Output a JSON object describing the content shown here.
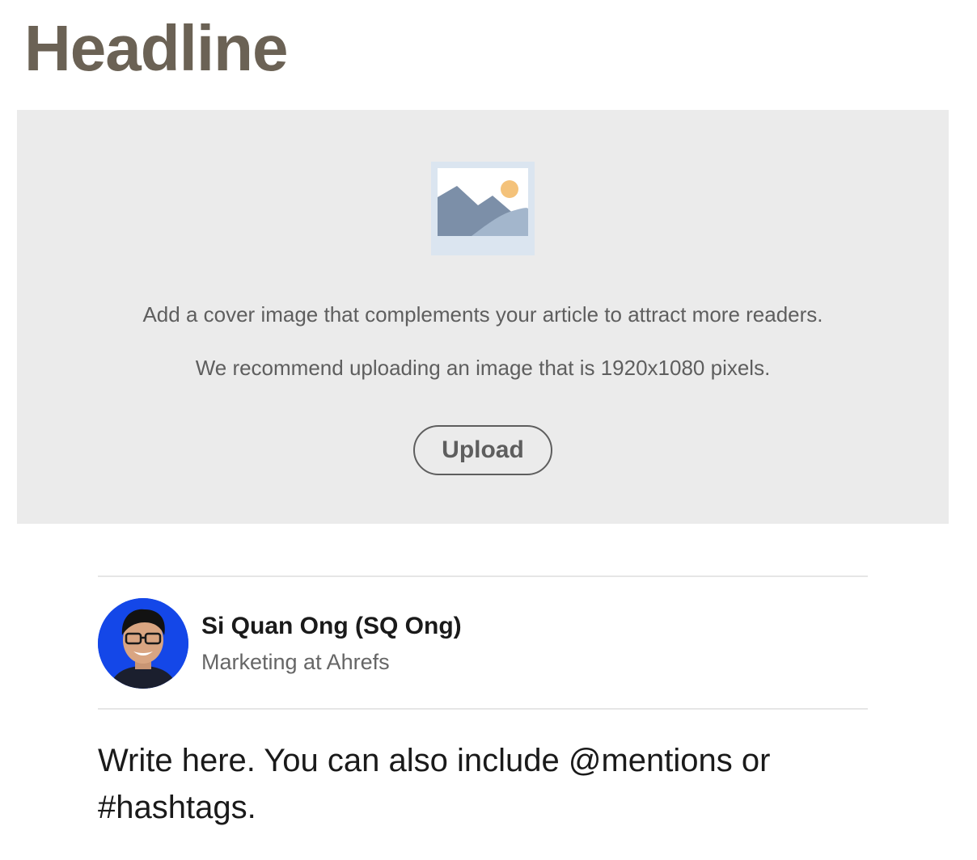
{
  "headline": {
    "placeholder": "Headline"
  },
  "cover": {
    "icon": "image-placeholder-icon",
    "description": "Add a cover image that complements your article to attract more readers.",
    "recommendation": "We recommend uploading an image that is 1920x1080 pixels.",
    "upload_label": "Upload"
  },
  "author": {
    "name": "Si Quan Ong (SQ Ong)",
    "role": "Marketing at Ahrefs",
    "avatar_icon": "profile-photo"
  },
  "editor": {
    "placeholder": "Write here. You can also include @mentions or #hashtags."
  },
  "colors": {
    "headline": "#6b6255",
    "cover_background": "#ebebeb",
    "illustration_frame": "#dbe5f0",
    "mountain_dark": "#7c8fa8",
    "mountain_light": "#a3b6cc",
    "sun": "#f4c27a",
    "avatar_background": "#1447e8"
  }
}
